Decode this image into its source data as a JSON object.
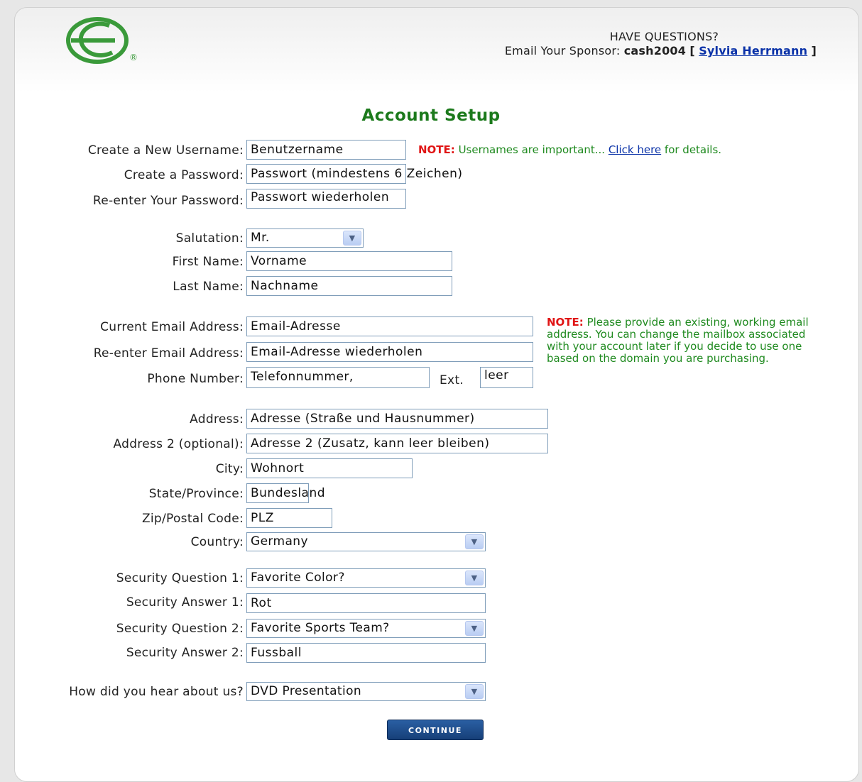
{
  "header": {
    "questions": "HAVE QUESTIONS?",
    "sponsor_prefix": "Email Your Sponsor:",
    "sponsor_id": "cash2004",
    "bracket_open": "[",
    "sponsor_name": "Sylvia Herrmann",
    "bracket_close": "]",
    "registered_mark": "®"
  },
  "title": "Account Setup",
  "notes": {
    "username_label": "NOTE:",
    "username_text": " Usernames are important... ",
    "username_link": "Click here",
    "username_after": " for details.",
    "email_label": "NOTE:",
    "email_text": " Please provide an existing, working email address. You can change the mailbox associated with your account later if you decide to use one based on the domain you are purchasing."
  },
  "form": {
    "username_label": "Create a New Username:",
    "username_value": "Benutzername",
    "password_label": "Create a Password:",
    "password_value": "Passwort (mindestens 6 Zeichen)",
    "password2_label": "Re-enter Your Password:",
    "password2_value": "Passwort wiederholen",
    "salutation_label": "Salutation:",
    "salutation_value": "Mr.",
    "first_name_label": "First Name:",
    "first_name_value": "Vorname",
    "last_name_label": "Last Name:",
    "last_name_value": "Nachname",
    "email_label": "Current Email Address:",
    "email_value": "Email-Adresse",
    "email2_label": "Re-enter Email Address:",
    "email2_value": "Email-Adresse wiederholen",
    "phone_label": "Phone Number:",
    "phone_value": "Telefonnummer,",
    "ext_label": "Ext.",
    "ext_value": "leer",
    "address_label": "Address:",
    "address_value": "Adresse (Straße und Hausnummer)",
    "address2_label": "Address 2 (optional):",
    "address2_value": "Adresse 2 (Zusatz, kann leer bleiben)",
    "city_label": "City:",
    "city_value": "Wohnort",
    "state_label": "State/Province:",
    "state_value": "Bundesland",
    "zip_label": "Zip/Postal Code:",
    "zip_value": "PLZ",
    "country_label": "Country:",
    "country_value": "Germany",
    "sq1_label": "Security Question 1:",
    "sq1_value": "Favorite Color?",
    "sa1_label": "Security Answer 1:",
    "sa1_value": "Rot",
    "sq2_label": "Security Question 2:",
    "sq2_value": "Favorite Sports Team?",
    "sa2_label": "Security Answer 2:",
    "sa2_value": "Fussball",
    "heard_label": "How did you hear about us?",
    "heard_value": "DVD Presentation"
  },
  "continue_label": "CONTINUE",
  "colors": {
    "title_green": "#1c7a1c",
    "note_red": "#e01515",
    "note_green": "#1f8a1f",
    "link_blue": "#0a32a8",
    "button_blue": "#1f4f8f",
    "input_border": "#7f9db9"
  },
  "icons": {
    "logo": "green-circle-e-logo",
    "dropdown": "chevron-down-icon"
  }
}
